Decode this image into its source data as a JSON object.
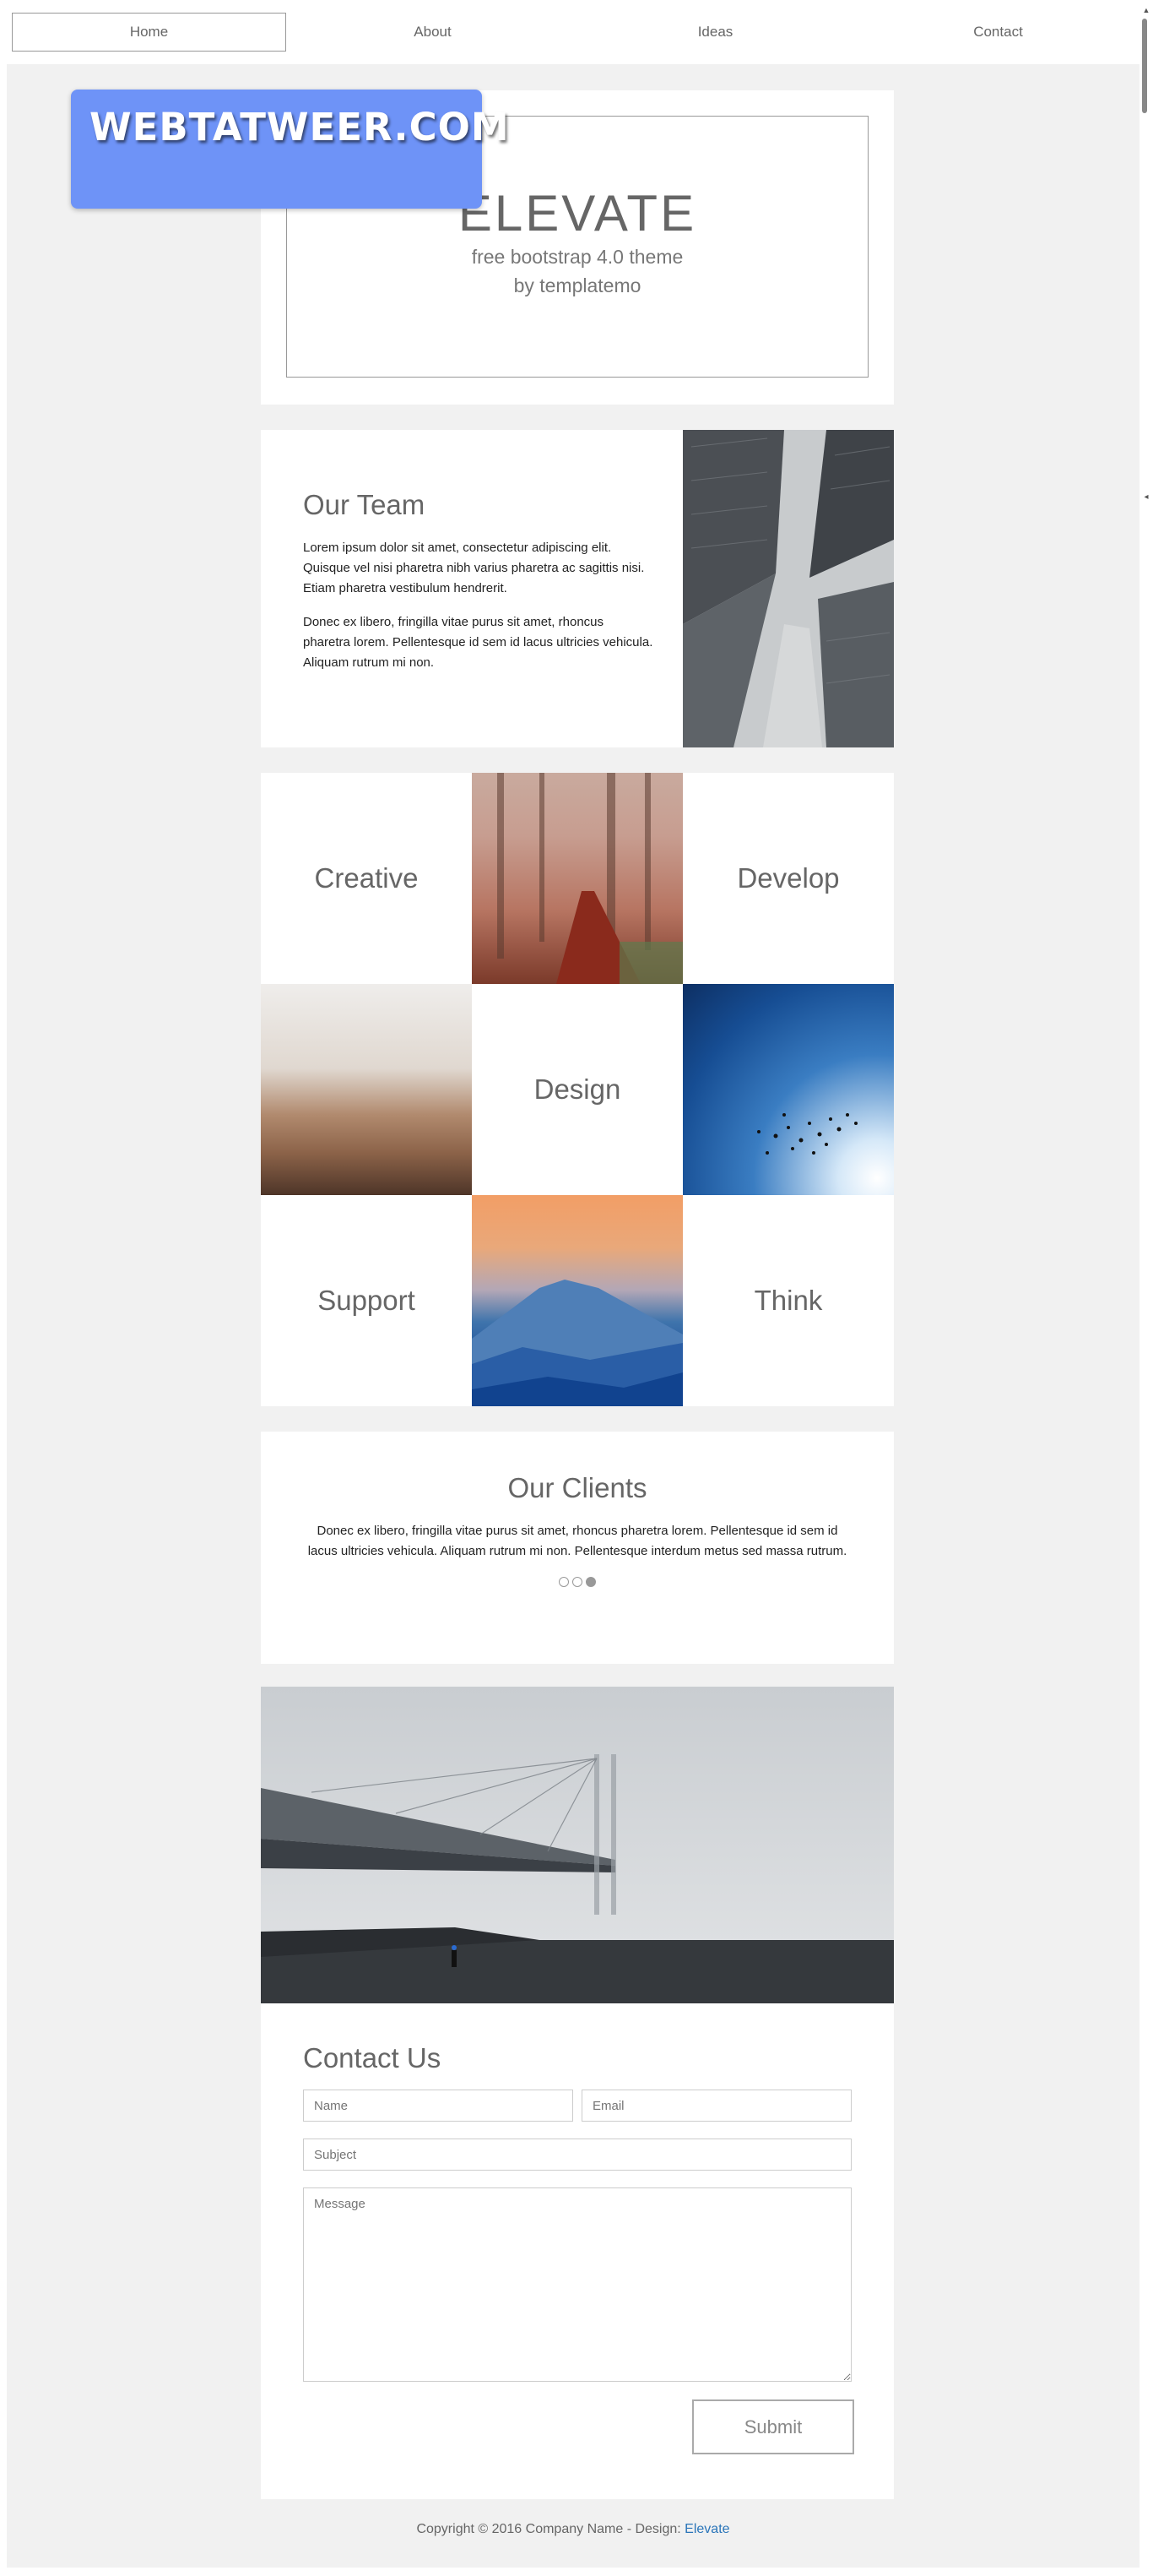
{
  "nav": {
    "items": [
      {
        "label": "Home"
      },
      {
        "label": "About"
      },
      {
        "label": "Ideas"
      },
      {
        "label": "Contact"
      }
    ]
  },
  "watermark": "WEBTATWEER.COM",
  "hero": {
    "title": "ELEVATE",
    "subtitle_line1": "free bootstrap 4.0 theme",
    "subtitle_line2": "by templatemo"
  },
  "team": {
    "title": "Our Team",
    "paragraph1": "Lorem ipsum dolor sit amet, consectetur adipiscing elit. Quisque vel nisi pharetra nibh varius pharetra ac sagittis nisi. Etiam pharetra vestibulum hendrerit.",
    "paragraph2": "Donec ex libero, fringilla vitae purus sit amet, rhoncus pharetra lorem. Pellentesque id sem id lacus ultricies vehicula. Aliquam rutrum mi non."
  },
  "grid": {
    "creative": "Creative",
    "develop": "Develop",
    "design": "Design",
    "support": "Support",
    "think": "Think"
  },
  "clients": {
    "title": "Our Clients",
    "text": "Donec ex libero, fringilla vitae purus sit amet, rhoncus pharetra lorem. Pellentesque id sem id lacus ultricies vehicula. Aliquam rutrum mi non. Pellentesque interdum metus sed massa rutrum."
  },
  "contact": {
    "title": "Contact Us",
    "name_placeholder": "Name",
    "email_placeholder": "Email",
    "subject_placeholder": "Subject",
    "message_placeholder": "Message",
    "submit_label": "Submit"
  },
  "footer": {
    "text": "Copyright © 2016 Company Name - Design: ",
    "link": "Elevate"
  },
  "colors": {
    "page_bg": "#f1f1f1",
    "watermark_bg": "#6e93f7",
    "link": "#2a75b9"
  }
}
